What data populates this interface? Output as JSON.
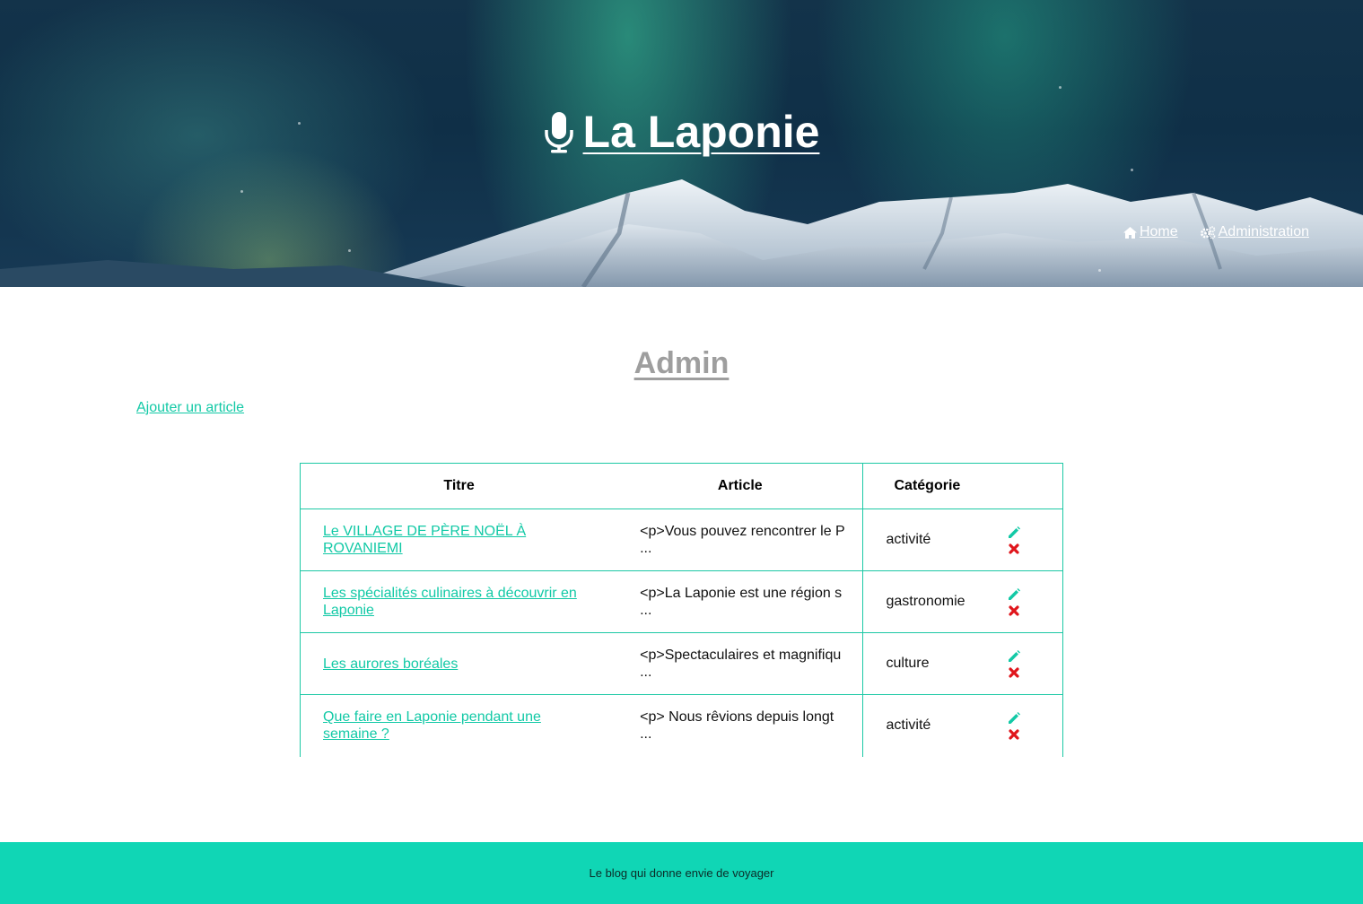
{
  "header": {
    "title": "La Laponie",
    "title_icon": "microphone-icon",
    "nav": [
      {
        "label": "Home",
        "icon": "home-icon"
      },
      {
        "label": " Administration",
        "icon": "gears-icon"
      }
    ]
  },
  "main": {
    "heading": "Admin",
    "add_link": "Ajouter un article",
    "table": {
      "headers": [
        "Titre",
        "Article",
        "Catégorie"
      ],
      "rows": [
        {
          "titre": "Le VILLAGE DE PÈRE NOËL À ROVANIEMI",
          "article_line1": "<p>Vous pouvez rencontrer le P",
          "article_line2": "...",
          "categorie": "activité"
        },
        {
          "titre": "Les spécialités culinaires à découvrir en Laponie",
          "article_line1": "<p>La Laponie est une région s",
          "article_line2": "...",
          "categorie": "gastronomie"
        },
        {
          "titre": "Les aurores boréales",
          "article_line1": "<p>Spectaculaires et magnifiqu",
          "article_line2": "...",
          "categorie": "culture"
        },
        {
          "titre": "Que faire en Laponie pendant une semaine ?",
          "article_line1": "<p> Nous rêvions depuis longt",
          "article_line2": "...",
          "categorie": "activité"
        }
      ],
      "action_icons": [
        "pencil-icon",
        "delete-x-icon"
      ]
    }
  },
  "footer": {
    "text": "Le blog qui donne envie de voyager"
  },
  "colors": {
    "accent": "#12c9a6",
    "footer_bg": "#10d6b5",
    "delete": "#e0151b",
    "heading_gray": "#9e9e9e"
  }
}
